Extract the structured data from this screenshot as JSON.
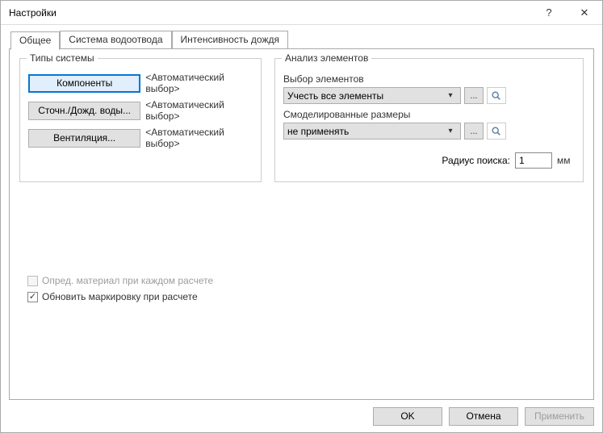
{
  "window": {
    "title": "Настройки",
    "help_icon": "?",
    "close_icon": "✕"
  },
  "tabs": {
    "general": "Общее",
    "drainage": "Система водоотвода",
    "intensity": "Интенсивность дождя"
  },
  "system_types": {
    "legend": "Типы системы",
    "components_btn": "Компоненты",
    "components_desc": "<Автоматический выбор>",
    "waste_btn": "Сточн./Дожд. воды...",
    "waste_desc": "<Автоматический выбор>",
    "vent_btn": "Вентиляция...",
    "vent_desc": "<Автоматический выбор>"
  },
  "analysis": {
    "legend": "Анализ элементов",
    "selection_label": "Выбор элементов",
    "selection_value": "Учесть все элементы",
    "sizes_label": "Смоделированные размеры",
    "sizes_value": "не применять",
    "ellipsis": "...",
    "radius_label": "Радиус поиска:",
    "radius_value": "1",
    "radius_unit": "мм"
  },
  "checks": {
    "material_label": "Опред. материал при каждом расчете",
    "marking_label": "Обновить маркировку при расчете",
    "marking_checked": "✓"
  },
  "buttons": {
    "ok": "OK",
    "cancel": "Отмена",
    "apply": "Применить"
  }
}
